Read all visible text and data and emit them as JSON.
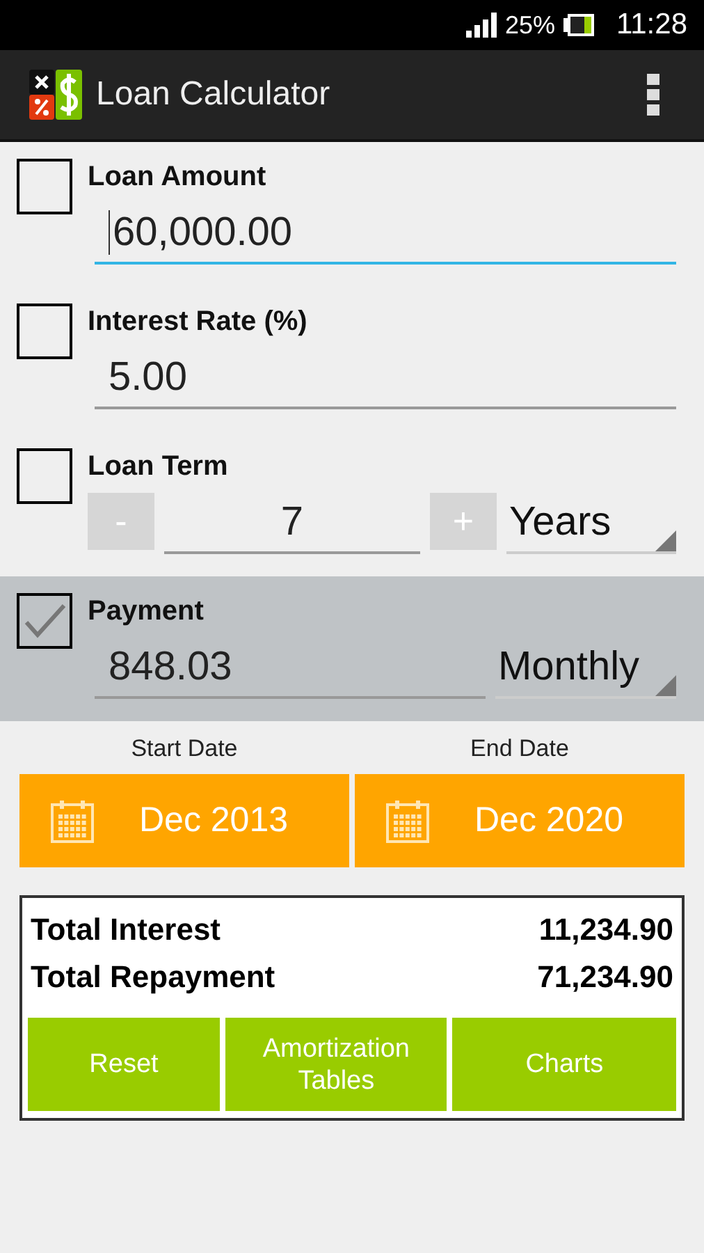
{
  "status_bar": {
    "battery": "25%",
    "time": "11:28"
  },
  "app_bar": {
    "title": "Loan Calculator"
  },
  "fields": [
    {
      "kind": "input",
      "label": "Loan Amount",
      "value": "60,000.00",
      "checked": false,
      "focused": true
    },
    {
      "kind": "input",
      "label": "Interest Rate (%)",
      "value": "5.00",
      "checked": false,
      "focused": false
    },
    {
      "kind": "stepper",
      "label": "Loan Term",
      "minus": "-",
      "value": "7",
      "plus": "+",
      "unit": "Years",
      "checked": false,
      "focused": false
    },
    {
      "kind": "input",
      "label": "Payment",
      "value": "848.03",
      "unit": "Monthly",
      "checked": true,
      "focused": false
    }
  ],
  "dates": [
    {
      "label": "Start Date",
      "value": "Dec 2013"
    },
    {
      "label": "End Date",
      "value": "Dec 2020"
    }
  ],
  "totals": [
    {
      "label": "Total Interest",
      "value": "11,234.90"
    },
    {
      "label": "Total Repayment",
      "value": "71,234.90"
    }
  ],
  "buttons": [
    "Reset",
    "Amortization Tables",
    "Charts"
  ]
}
